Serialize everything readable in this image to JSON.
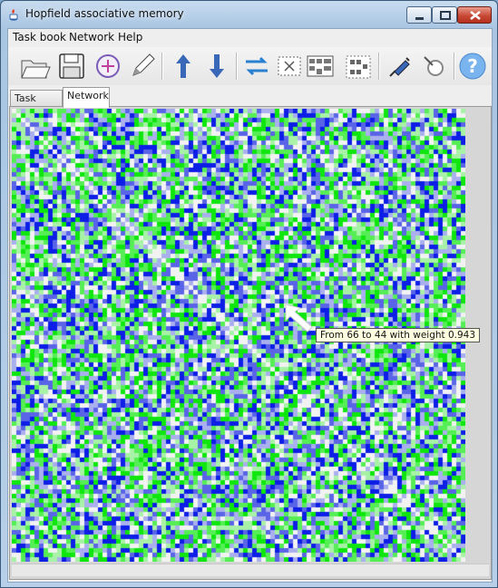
{
  "window": {
    "title": "Hopfield associative memory",
    "controls": [
      "minimize",
      "maximize",
      "close"
    ]
  },
  "menubar": {
    "items": [
      "Task book",
      "Network",
      "Help"
    ]
  },
  "toolbar": {
    "buttons": [
      {
        "name": "open-folder-icon"
      },
      {
        "name": "save-disk-icon"
      },
      {
        "name": "add-circle-icon"
      },
      {
        "name": "pencil-icon"
      },
      {
        "name": "arrow-up-icon"
      },
      {
        "name": "arrow-down-icon"
      },
      {
        "name": "swap-arrows-icon"
      },
      {
        "name": "clear-grid-icon"
      },
      {
        "name": "grid-pattern-icon"
      },
      {
        "name": "network-grid-icon"
      },
      {
        "name": "syringe-icon"
      },
      {
        "name": "settings-wand-icon"
      },
      {
        "name": "help-icon",
        "glyph": "?"
      }
    ]
  },
  "tabs": [
    {
      "label": "Task book",
      "selected": false
    },
    {
      "label": "Network",
      "selected": true
    }
  ],
  "weight_matrix": {
    "colors": {
      "positive_strong": "#0d1ee6",
      "positive_mid": "#5a64e6",
      "positive_light": "#aab0ee",
      "neutral": "#f2f2f2",
      "negative_light": "#a8f2a8",
      "negative_mid": "#55ee55",
      "negative_strong": "#0ee60e"
    }
  },
  "tooltip": {
    "text": "From 66 to 44 with weight 0.943"
  }
}
